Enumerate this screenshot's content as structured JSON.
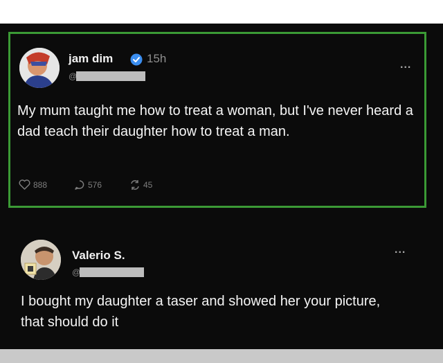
{
  "post": {
    "author": "jam dim",
    "handle_prefix": "@",
    "time": "15h",
    "more": "...",
    "text": "My mum taught me how to treat a woman, but I've never heard a dad teach their daughter how to treat a man.",
    "likes": "888",
    "replies": "576",
    "reposts": "45",
    "highlight_color": "#3b9a35"
  },
  "reply": {
    "author": "Valerio S.",
    "handle_prefix": "@",
    "more": "...",
    "text": "I bought my daughter a taser and showed her your picture, that should do it"
  },
  "icons": [
    "verified-badge-icon",
    "heart-icon",
    "reply-icon",
    "repost-icon",
    "more-icon"
  ]
}
